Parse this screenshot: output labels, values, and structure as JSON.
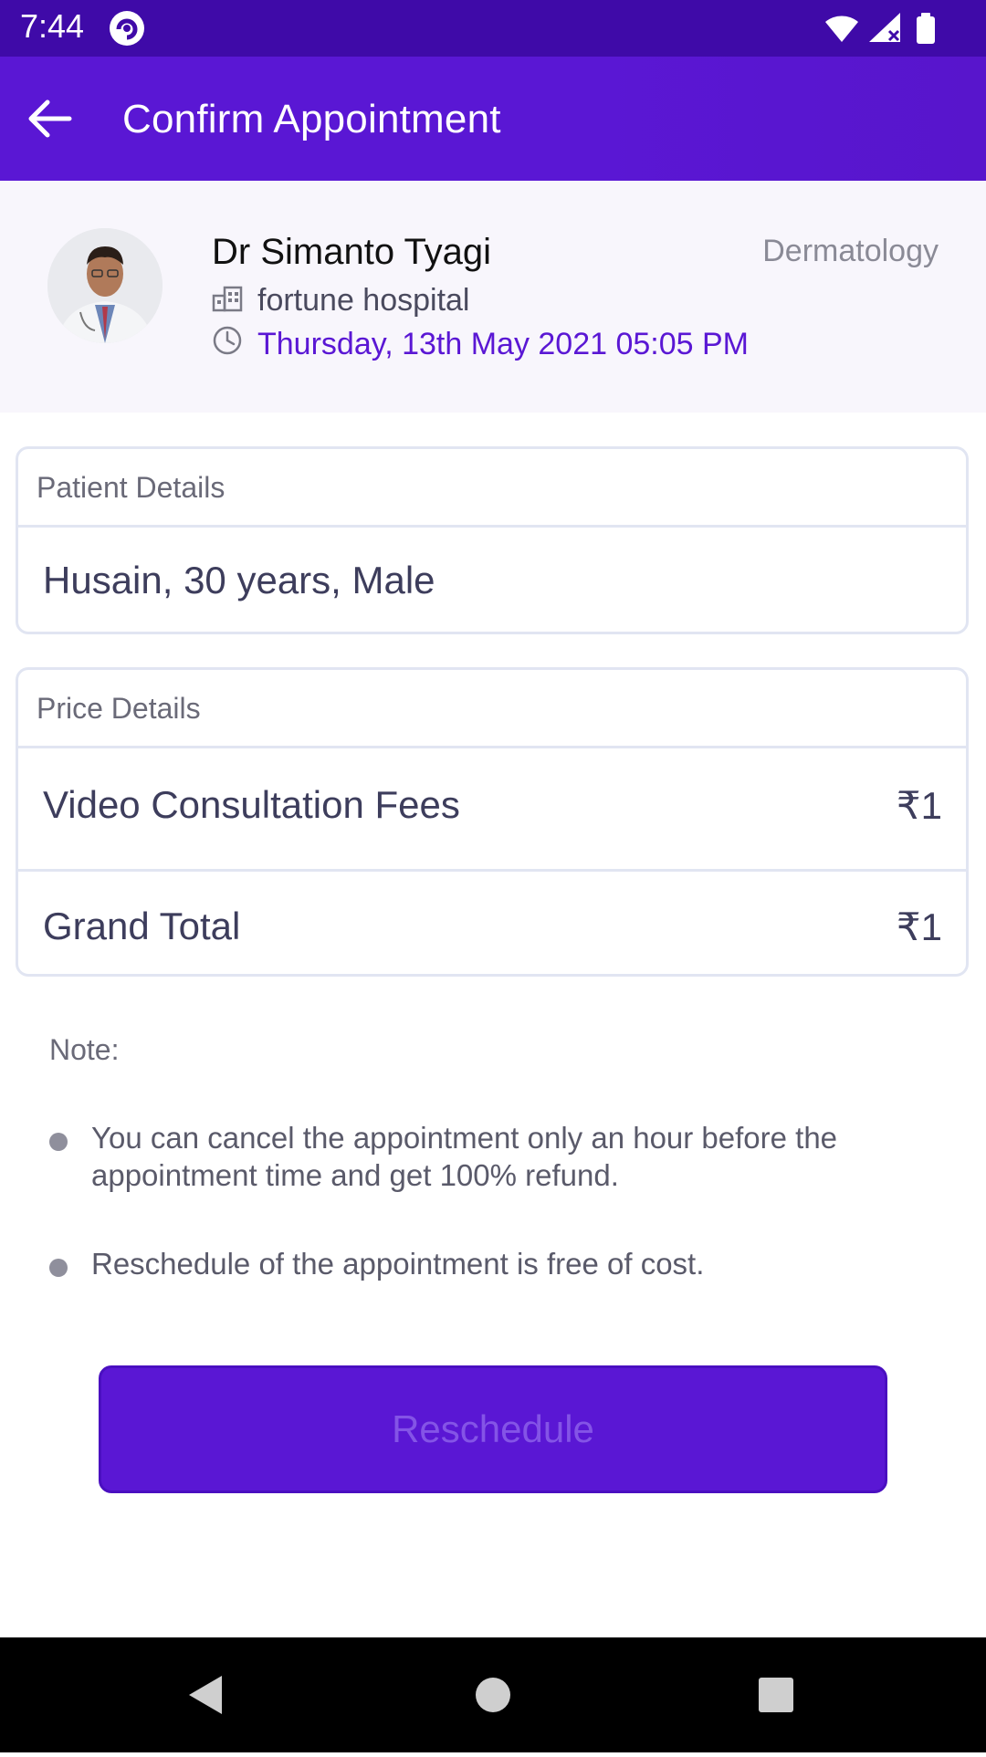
{
  "status_bar": {
    "time": "7:44",
    "icons": [
      "app-notification-icon",
      "wifi-icon",
      "signal-icon",
      "battery-icon"
    ]
  },
  "app_bar": {
    "title": "Confirm Appointment",
    "back_icon": "arrow-left-icon"
  },
  "doctor": {
    "name": "Dr Simanto Tyagi",
    "specialty": "Dermatology",
    "hospital": "fortune hospital",
    "appointment_time": "Thursday, 13th May 2021 05:05 PM"
  },
  "patient_details": {
    "title": "Patient Details",
    "value": "Husain, 30 years, Male"
  },
  "price_details": {
    "title": "Price Details",
    "rows": [
      {
        "label": "Video Consultation Fees",
        "value": "₹1"
      },
      {
        "label": "Grand Total",
        "value": "₹1"
      }
    ]
  },
  "note": {
    "title": "Note:",
    "items": [
      "You can cancel the appointment only an hour before the appointment time and get 100% refund.",
      "Reschedule of the appointment is free of cost."
    ]
  },
  "actions": {
    "reschedule_label": "Reschedule"
  },
  "colors": {
    "primary": "#5a17d4",
    "status_bar": "#3f0aa8",
    "card_background": "#f8f6fc",
    "border": "#e1e5f2"
  }
}
